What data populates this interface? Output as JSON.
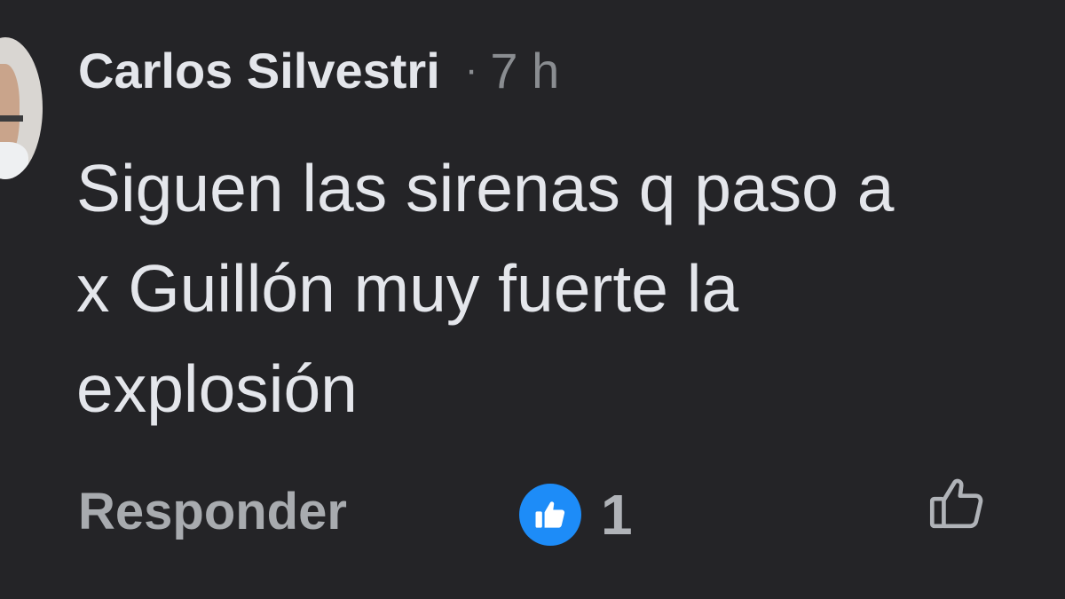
{
  "comment": {
    "author": "Carlos Silvestri",
    "separator": "·",
    "timestamp": "7 h",
    "text_lines": [
      "Siguen las sirenas q paso a",
      "x Guillón muy fuerte la",
      "explosión"
    ]
  },
  "actions": {
    "reply_label": "Responder",
    "reaction_count": "1",
    "reaction_icon": "thumbs-up-icon",
    "like_icon": "thumbs-up-outline-icon"
  },
  "colors": {
    "background": "#242427",
    "primary_text": "#e4e6eb",
    "secondary_text": "#8a8d91",
    "like_blue": "#1d8cf8"
  }
}
